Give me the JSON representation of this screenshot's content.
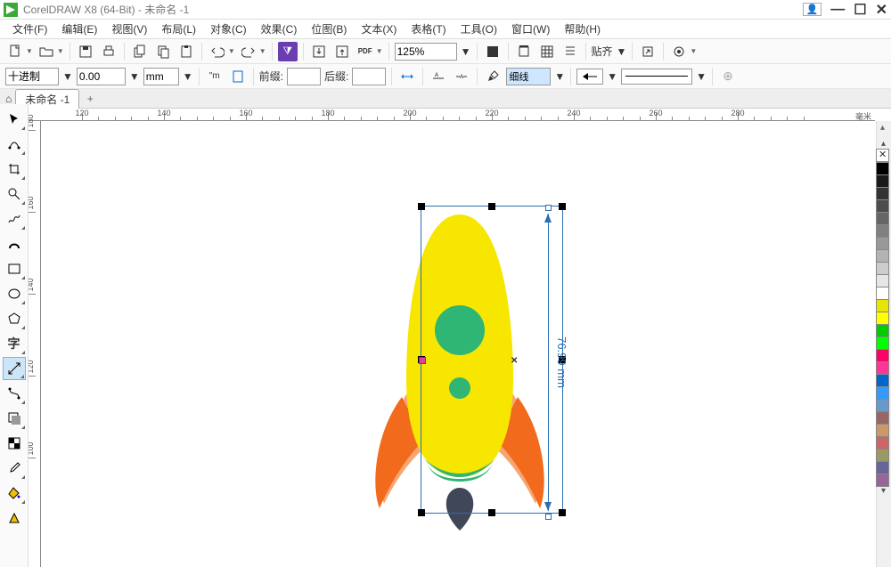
{
  "title": "CorelDRAW X8 (64-Bit) - 未命名 -1",
  "menu": [
    "文件(F)",
    "编辑(E)",
    "视图(V)",
    "布局(L)",
    "对象(C)",
    "效果(C)",
    "位图(B)",
    "文本(X)",
    "表格(T)",
    "工具(O)",
    "窗口(W)",
    "帮助(H)"
  ],
  "zoom": "125%",
  "align_label": "贴齐",
  "prop": {
    "units_mode": "十进制",
    "value": "0.00",
    "units": "mm",
    "prefix_label": "前缀:",
    "suffix_label": "后缀:",
    "prefix": "",
    "suffix": "",
    "lineweight": "细线"
  },
  "doc_tab": "未命名 -1",
  "ruler_h": [
    120,
    140,
    160,
    180,
    200,
    220,
    240,
    260,
    280
  ],
  "ruler_h_end": "毫米",
  "ruler_v": [
    180,
    160,
    140,
    120,
    100
  ],
  "dimension": "76.99 mm",
  "palette": [
    "#000000",
    "#1a1a1a",
    "#333333",
    "#4d4d4d",
    "#666666",
    "#808080",
    "#999999",
    "#b3b3b3",
    "#cccccc",
    "#e6e6e6",
    "#ffffff",
    "#e6e600",
    "#ffff00",
    "#00cc00",
    "#00ff00",
    "#ff0066",
    "#ff3399",
    "#0066cc",
    "#3399ff",
    "#6699cc",
    "#996666",
    "#cc9966",
    "#cc6666",
    "#999966",
    "#666699",
    "#996699"
  ]
}
